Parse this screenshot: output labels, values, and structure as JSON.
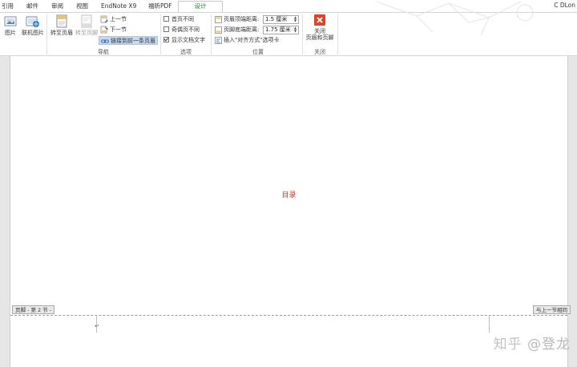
{
  "tabs": [
    {
      "label": "引用"
    },
    {
      "label": "邮件"
    },
    {
      "label": "审阅"
    },
    {
      "label": "视图"
    },
    {
      "label": "EndNote X9"
    },
    {
      "label": "福昕PDF"
    },
    {
      "label": "设计"
    }
  ],
  "user_label": "C DLon",
  "groups": {
    "insert": {
      "picture": "图片",
      "online_picture": "联机图片"
    },
    "navigation": {
      "label": "导航",
      "goto_header": "转至页眉",
      "goto_footer": "转至页脚",
      "prev_section": "上一节",
      "next_section": "下一节",
      "link_previous": "链接到前一条页眉"
    },
    "options": {
      "label": "选项",
      "first_page_diff": "首页不同",
      "odd_even_diff": "奇偶页不同",
      "show_doc_text": "显示文档文字",
      "first_page_diff_checked": false,
      "odd_even_diff_checked": false,
      "show_doc_text_checked": true
    },
    "position": {
      "label": "位置",
      "header_top_label": "页眉顶端距离:",
      "header_top_value": "1.5 厘米",
      "footer_bottom_label": "页脚底端距离:",
      "footer_bottom_value": "1.75 厘米",
      "insert_align_tab": "插入\"对齐方式\"选项卡"
    },
    "close": {
      "label": "关闭",
      "close_button_line1": "关闭",
      "close_button_line2": "页眉和页脚"
    }
  },
  "document": {
    "body_text": "目录",
    "footer_tag": "页脚 - 第 2 节 -",
    "same_as_previous": "与上一节相同",
    "paragraph_mark": "↵"
  },
  "watermark": {
    "site": "知乎",
    "handle": "@登龙"
  },
  "colors": {
    "accent_tab": "#2b7c3f",
    "body_text": "#c0392b",
    "close_icon": "#d9472b",
    "selected_bg": "#c5d9f1"
  }
}
